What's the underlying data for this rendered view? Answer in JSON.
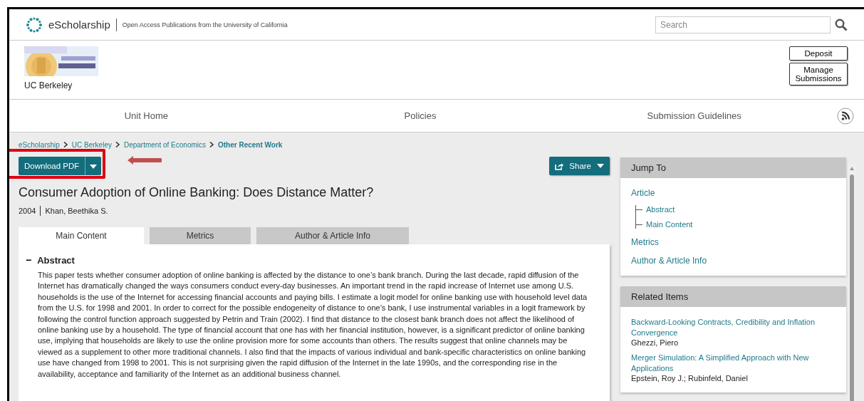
{
  "header": {
    "site": "eScholarship",
    "tagline": "Open Access Publications from the University of California",
    "search": {
      "placeholder": "Search"
    }
  },
  "unit": {
    "name": "UC Berkeley",
    "logo": {
      "kind": "picture"
    },
    "buttons": [
      "Deposit",
      "Manage Submissions"
    ]
  },
  "nav": {
    "items": [
      "Unit Home",
      "Policies",
      "Submission Guidelines"
    ]
  },
  "breadcrumb": [
    {
      "label": "eScholarship",
      "current": false
    },
    {
      "label": "UC Berkeley",
      "current": false
    },
    {
      "label": "Department of Economics",
      "current": false
    },
    {
      "label": "Other Recent Work",
      "current": true
    }
  ],
  "download": {
    "label": "Download PDF"
  },
  "share": {
    "label": "Share"
  },
  "article": {
    "title": "Consumer Adoption of Online Banking: Does Distance Matter?",
    "year": "2004",
    "author": "Khan, Beethika S."
  },
  "tabs": [
    {
      "label": "Main Content",
      "selected": true
    },
    {
      "label": "Metrics",
      "selected": false
    },
    {
      "label": "Author & Article Info",
      "selected": false
    }
  ],
  "abstract": {
    "heading": "Abstract",
    "toggle": "−",
    "expanded": true,
    "text": "This paper tests whether consumer adoption of online banking is affected by the distance to one’s bank branch. During the last decade, rapid diffusion of the Internet has dramatically changed the ways consumers conduct every-day businesses. An important trend in the rapid increase of Internet use among U.S. households is the use of the Internet for accessing financial accounts and paying bills. I estimate a logit model for online banking use with household level data from the U.S. for 1998 and 2001. In order to correct for the possible endogeneity of distance to one’s bank, I use instrumental variables in a logit framework by following the control function approach suggested by Petrin and Train (2002). I find that distance to the closest bank branch does not affect the likelihood of online banking use by a household. The type of financial account that one has with her financial institution, however, is a significant predictor of online banking use, implying that households are likely to use the online provision more for some accounts than others. The results suggest that online channels may be viewed as a supplement to other more traditional channels. I also find that the impacts of various individual and bank-specific characteristics on online banking use have changed from 1998 to 2001. This is not surprising given the rapid diffusion of the Internet in the late 1990s, and the corresponding rise in the availability, acceptance and familiarity of the Internet as an additional business channel."
  },
  "jump_to": {
    "title": "Jump To",
    "items": [
      {
        "label": "Article",
        "children": [
          {
            "label": "Abstract"
          },
          {
            "label": "Main Content"
          }
        ]
      },
      {
        "label": "Metrics"
      },
      {
        "label": "Author & Article Info"
      }
    ]
  },
  "related": {
    "title": "Related Items",
    "items": [
      {
        "title": "Backward-Looking Contracts, Credibility and Inflation Convergence",
        "authors": "Ghezzi, Piero"
      },
      {
        "title": "Merger Simulation: A Simplified Approach with New Applications",
        "authors": "Epstein, Roy J.;  Rubinfeld, Daniel"
      }
    ]
  }
}
